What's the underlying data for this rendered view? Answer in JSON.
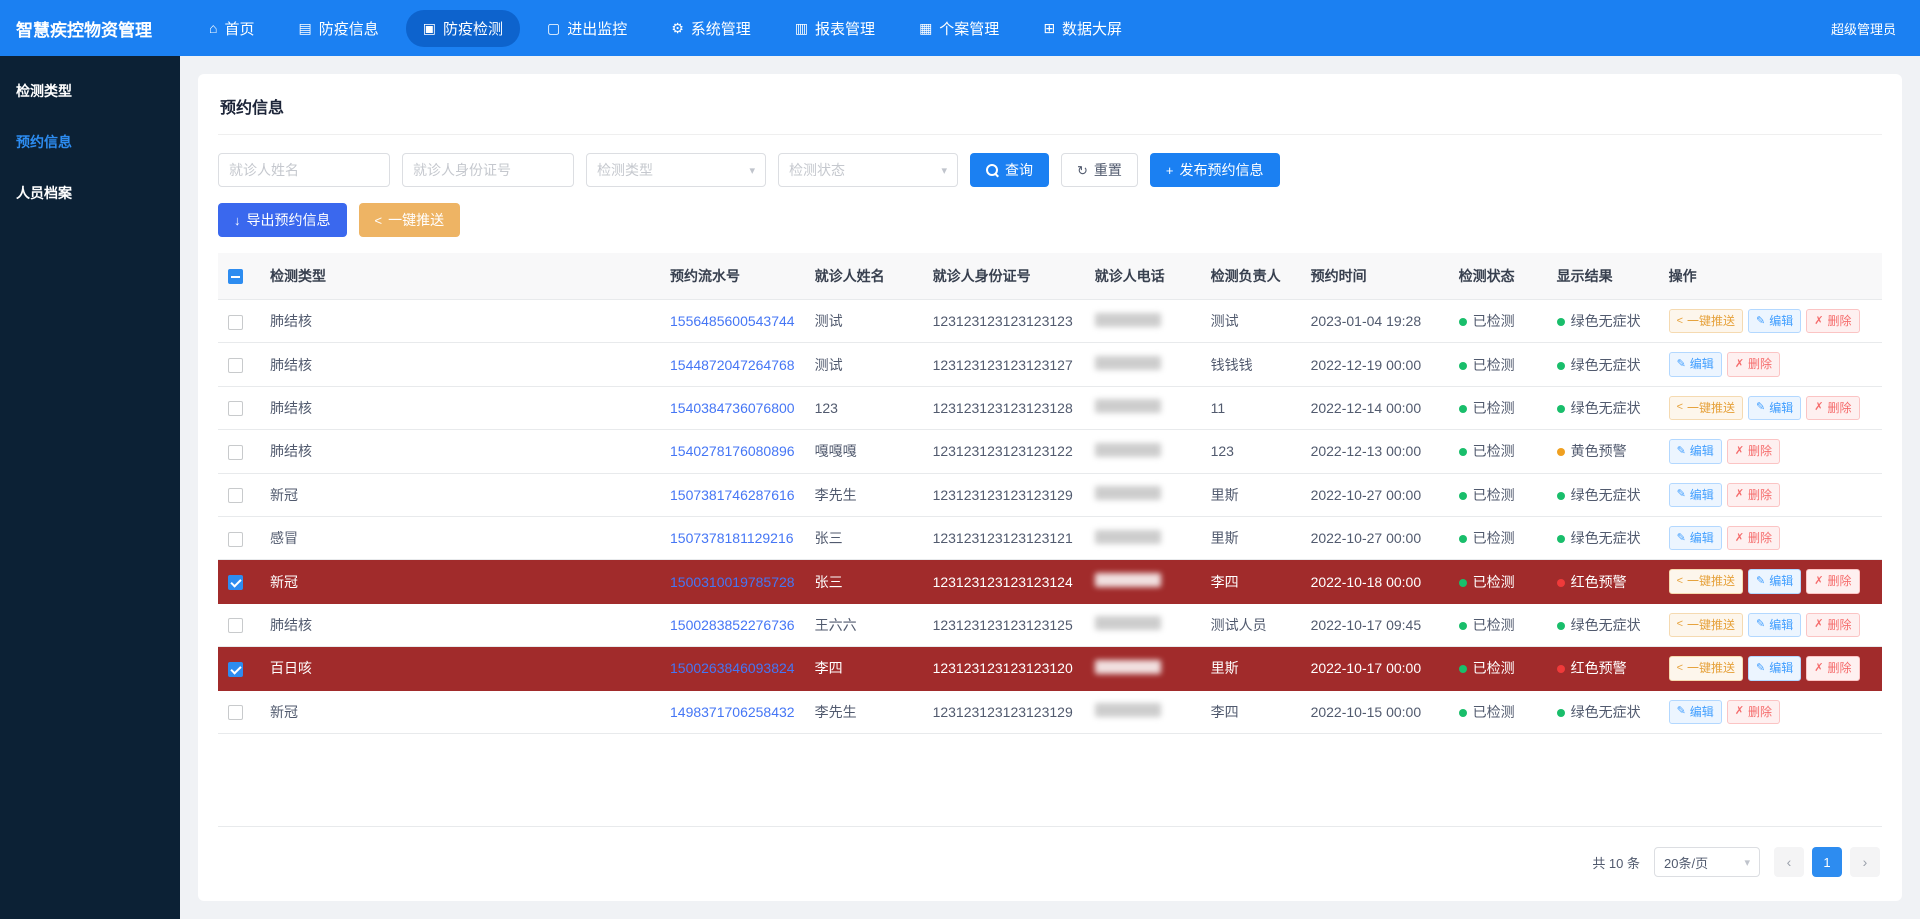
{
  "colors": {
    "topbar_blue": "#1b80f2",
    "sidebar_navy": "#0c2135",
    "highlight_row_red": "#a12b2b",
    "status_green": "#19be6b",
    "warning_yellow": "#f0a020",
    "alert_red": "#f03a3a",
    "link_blue": "#4576f5",
    "push_orange": "#e6a23c"
  },
  "icons": {
    "reset": "↻",
    "plus": "+",
    "download": "↓",
    "push": "<",
    "edit": "✎",
    "delete": "✗",
    "chevron_down": "▾",
    "prev": "‹",
    "next": "›"
  },
  "topbar": {
    "brand": "智慧疾控物资管理",
    "user": "超级管理员",
    "items": [
      {
        "label": "首页",
        "icon": "home",
        "glyph": "⌂",
        "active": false
      },
      {
        "label": "防疫信息",
        "icon": "doc",
        "glyph": "▤",
        "active": false
      },
      {
        "label": "防疫检测",
        "icon": "test",
        "glyph": "▣",
        "active": true
      },
      {
        "label": "进出监控",
        "icon": "monitor",
        "glyph": "▢",
        "active": false
      },
      {
        "label": "系统管理",
        "icon": "gear",
        "glyph": "⚙",
        "active": false
      },
      {
        "label": "报表管理",
        "icon": "report",
        "glyph": "▥",
        "active": false
      },
      {
        "label": "个案管理",
        "icon": "folder",
        "glyph": "▦",
        "active": false
      },
      {
        "label": "数据大屏",
        "icon": "screen",
        "glyph": "⊞",
        "active": false
      }
    ]
  },
  "sidebar": {
    "items": [
      {
        "label": "检测类型",
        "active": false
      },
      {
        "label": "预约信息",
        "active": true
      },
      {
        "label": "人员档案",
        "active": false
      }
    ]
  },
  "page": {
    "title": "预约信息",
    "filters": {
      "name_placeholder": "就诊人姓名",
      "id_placeholder": "就诊人身份证号",
      "type_placeholder": "检测类型",
      "status_placeholder": "检测状态",
      "search_label": "查询",
      "reset_label": "重置",
      "publish_label": "发布预约信息"
    },
    "toolbar": {
      "export_label": "导出预约信息",
      "push_label": "一键推送"
    },
    "table": {
      "columns": [
        "检测类型",
        "预约流水号",
        "就诊人姓名",
        "就诊人身份证号",
        "就诊人电话",
        "检测负责人",
        "预约时间",
        "检测状态",
        "显示结果",
        "操作"
      ],
      "action_labels": {
        "push": "一键推送",
        "edit": "编辑",
        "delete": "删除"
      },
      "rows": [
        {
          "type": "肺结核",
          "serial": "1556485600543744",
          "name": "测试",
          "id_card": "123123123123123123",
          "phone_redacted": true,
          "manager": "测试",
          "time": "2023-01-04 19:28",
          "status": "已检测",
          "result": "绿色无症状",
          "result_color": "green",
          "checked": false,
          "highlighted": false,
          "actions": [
            "push",
            "edit",
            "delete"
          ]
        },
        {
          "type": "肺结核",
          "serial": "1544872047264768",
          "name": "测试",
          "id_card": "123123123123123127",
          "phone_redacted": true,
          "manager": "钱钱钱",
          "time": "2022-12-19 00:00",
          "status": "已检测",
          "result": "绿色无症状",
          "result_color": "green",
          "checked": false,
          "highlighted": false,
          "actions": [
            "edit",
            "delete"
          ]
        },
        {
          "type": "肺结核",
          "serial": "1540384736076800",
          "name": "123",
          "id_card": "123123123123123128",
          "phone_redacted": true,
          "manager": "11",
          "time": "2022-12-14 00:00",
          "status": "已检测",
          "result": "绿色无症状",
          "result_color": "green",
          "checked": false,
          "highlighted": false,
          "actions": [
            "push",
            "edit",
            "delete"
          ]
        },
        {
          "type": "肺结核",
          "serial": "1540278176080896",
          "name": "嘎嘎嘎",
          "id_card": "123123123123123122",
          "phone_redacted": true,
          "manager": "123",
          "time": "2022-12-13 00:00",
          "status": "已检测",
          "result": "黄色预警",
          "result_color": "yellow",
          "checked": false,
          "highlighted": false,
          "actions": [
            "edit",
            "delete"
          ]
        },
        {
          "type": "新冠",
          "serial": "1507381746287616",
          "name": "李先生",
          "id_card": "123123123123123129",
          "phone_redacted": true,
          "manager": "里斯",
          "time": "2022-10-27 00:00",
          "status": "已检测",
          "result": "绿色无症状",
          "result_color": "green",
          "checked": false,
          "highlighted": false,
          "actions": [
            "edit",
            "delete"
          ]
        },
        {
          "type": "感冒",
          "serial": "1507378181129216",
          "name": "张三",
          "id_card": "123123123123123121",
          "phone_redacted": true,
          "manager": "里斯",
          "time": "2022-10-27 00:00",
          "status": "已检测",
          "result": "绿色无症状",
          "result_color": "green",
          "checked": false,
          "highlighted": false,
          "actions": [
            "edit",
            "delete"
          ]
        },
        {
          "type": "新冠",
          "serial": "1500310019785728",
          "name": "张三",
          "id_card": "123123123123123124",
          "phone_redacted": true,
          "manager": "李四",
          "time": "2022-10-18 00:00",
          "status": "已检测",
          "result": "红色预警",
          "result_color": "red",
          "checked": true,
          "highlighted": true,
          "actions": [
            "push",
            "edit",
            "delete"
          ]
        },
        {
          "type": "肺结核",
          "serial": "1500283852276736",
          "name": "王六六",
          "id_card": "123123123123123125",
          "phone_redacted": true,
          "manager": "测试人员",
          "time": "2022-10-17 09:45",
          "status": "已检测",
          "result": "绿色无症状",
          "result_color": "green",
          "checked": false,
          "highlighted": false,
          "actions": [
            "push",
            "edit",
            "delete"
          ]
        },
        {
          "type": "百日咳",
          "serial": "1500263846093824",
          "name": "李四",
          "id_card": "123123123123123120",
          "phone_redacted": true,
          "manager": "里斯",
          "time": "2022-10-17 00:00",
          "status": "已检测",
          "result": "红色预警",
          "result_color": "red",
          "checked": true,
          "highlighted": true,
          "actions": [
            "push",
            "edit",
            "delete"
          ]
        },
        {
          "type": "新冠",
          "serial": "1498371706258432",
          "name": "李先生",
          "id_card": "123123123123123129",
          "phone_redacted": true,
          "manager": "李四",
          "time": "2022-10-15 00:00",
          "status": "已检测",
          "result": "绿色无症状",
          "result_color": "green",
          "checked": false,
          "highlighted": false,
          "actions": [
            "edit",
            "delete"
          ]
        }
      ]
    },
    "pagination": {
      "total_text": "共 10 条",
      "page_size": "20条/页",
      "current_page": "1"
    }
  }
}
